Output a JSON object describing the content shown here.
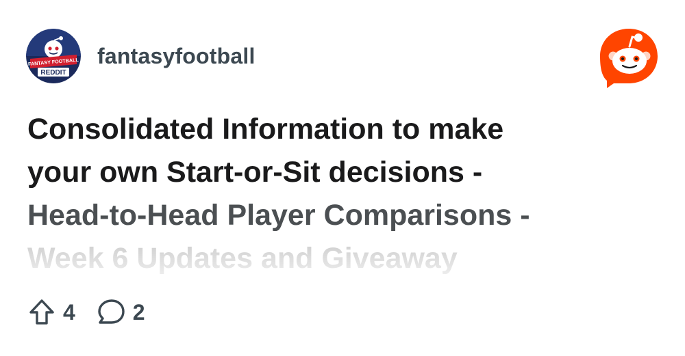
{
  "post": {
    "subreddit": "fantasyfootball",
    "title_lines": [
      "Consolidated Information to make",
      "your own Start-or-Sit decisions -",
      "Head-to-Head Player Comparisons -",
      "Week 6 Updates and Giveaway"
    ],
    "upvotes": "4",
    "comments": "2"
  },
  "avatar": {
    "badge_line1": "FANTASY FOOTBALL",
    "badge_line2": "REDDIT"
  },
  "icons": {
    "subreddit_avatar": "fantasy-football-reddit-logo",
    "brand": "reddit-snoo-logo",
    "upvote": "upvote-arrow-icon",
    "comment": "comment-bubble-icon"
  },
  "colors": {
    "reddit_orange": "#ff4500",
    "avatar_navy": "#1b2a5c",
    "avatar_red": "#d11f2f",
    "text_dark": "#1a1a1b",
    "text_muted": "#3c4851"
  }
}
